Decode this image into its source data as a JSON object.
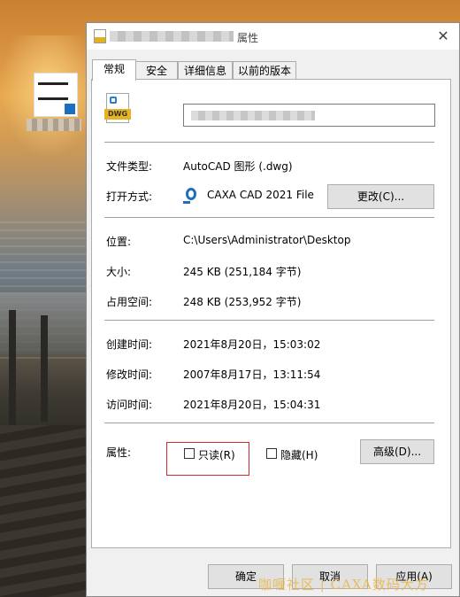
{
  "desktop": {
    "icon_label_obscured": true
  },
  "window": {
    "title_suffix": "属性",
    "close_glyph": "✕"
  },
  "tabs": [
    {
      "label": "常规",
      "active": true
    },
    {
      "label": "安全",
      "active": false
    },
    {
      "label": "详细信息",
      "active": false
    },
    {
      "label": "以前的版本",
      "active": false
    }
  ],
  "file": {
    "icon_badge": "DWG"
  },
  "rows": {
    "type_label": "文件类型:",
    "type_value": "AutoCAD 图形 (.dwg)",
    "open_label": "打开方式:",
    "open_value": "CAXA CAD 2021 File",
    "change_button": "更改(C)...",
    "location_label": "位置:",
    "location_value": "C:\\Users\\Administrator\\Desktop",
    "size_label": "大小:",
    "size_value": "245 KB (251,184 字节)",
    "disk_label": "占用空间:",
    "disk_value": "248 KB (253,952 字节)",
    "created_label": "创建时间:",
    "created_value": "2021年8月20日，15:03:02",
    "modified_label": "修改时间:",
    "modified_value": "2007年8月17日，13:11:54",
    "accessed_label": "访问时间:",
    "accessed_value": "2021年8月20日，15:04:31"
  },
  "attributes": {
    "label": "属性:",
    "readonly_label": "只读(R)",
    "readonly_checked": false,
    "hidden_label": "隐藏(H)",
    "hidden_checked": false,
    "advanced_button": "高级(D)..."
  },
  "footer": {
    "ok": "确定",
    "cancel": "取消",
    "apply": "应用(A)"
  },
  "watermark": "咖喱社区 | CAXA数码大方",
  "colors": {
    "highlight_frame": "#d9262a",
    "dialog_bg": "#f0f0f0",
    "panel_bg": "#ffffff",
    "dwg_badge": "#e6b422"
  }
}
